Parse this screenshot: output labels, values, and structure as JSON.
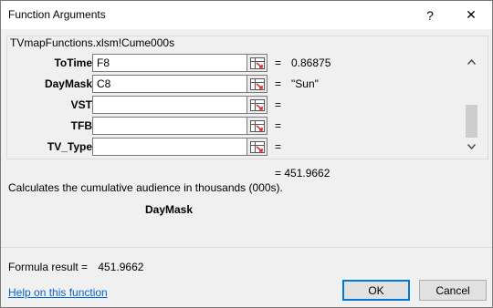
{
  "window": {
    "title": "Function Arguments",
    "help_glyph": "?",
    "close_glyph": "✕"
  },
  "group": {
    "label": "TVmapFunctions.xlsm!Cume000s"
  },
  "arguments": [
    {
      "name": "ToTime",
      "value": "F8",
      "equals": "=",
      "result": "0.86875"
    },
    {
      "name": "DayMask",
      "value": "C8",
      "equals": "=",
      "result": "\"Sun\""
    },
    {
      "name": "VST",
      "value": "",
      "equals": "=",
      "result": ""
    },
    {
      "name": "TFB",
      "value": "",
      "equals": "=",
      "result": ""
    },
    {
      "name": "TV_Type",
      "value": "",
      "equals": "=",
      "result": ""
    }
  ],
  "function_result": "=  451.9662",
  "description": "Calculates the cumulative audience in thousands (000s).",
  "current_argument": "DayMask",
  "formula_result": {
    "label": "Formula result =",
    "value": "451.9662"
  },
  "help_link": "Help on this function",
  "buttons": {
    "ok": "OK",
    "cancel": "Cancel"
  },
  "colors": {
    "accent": "#0078d7",
    "link": "#0066cc"
  }
}
